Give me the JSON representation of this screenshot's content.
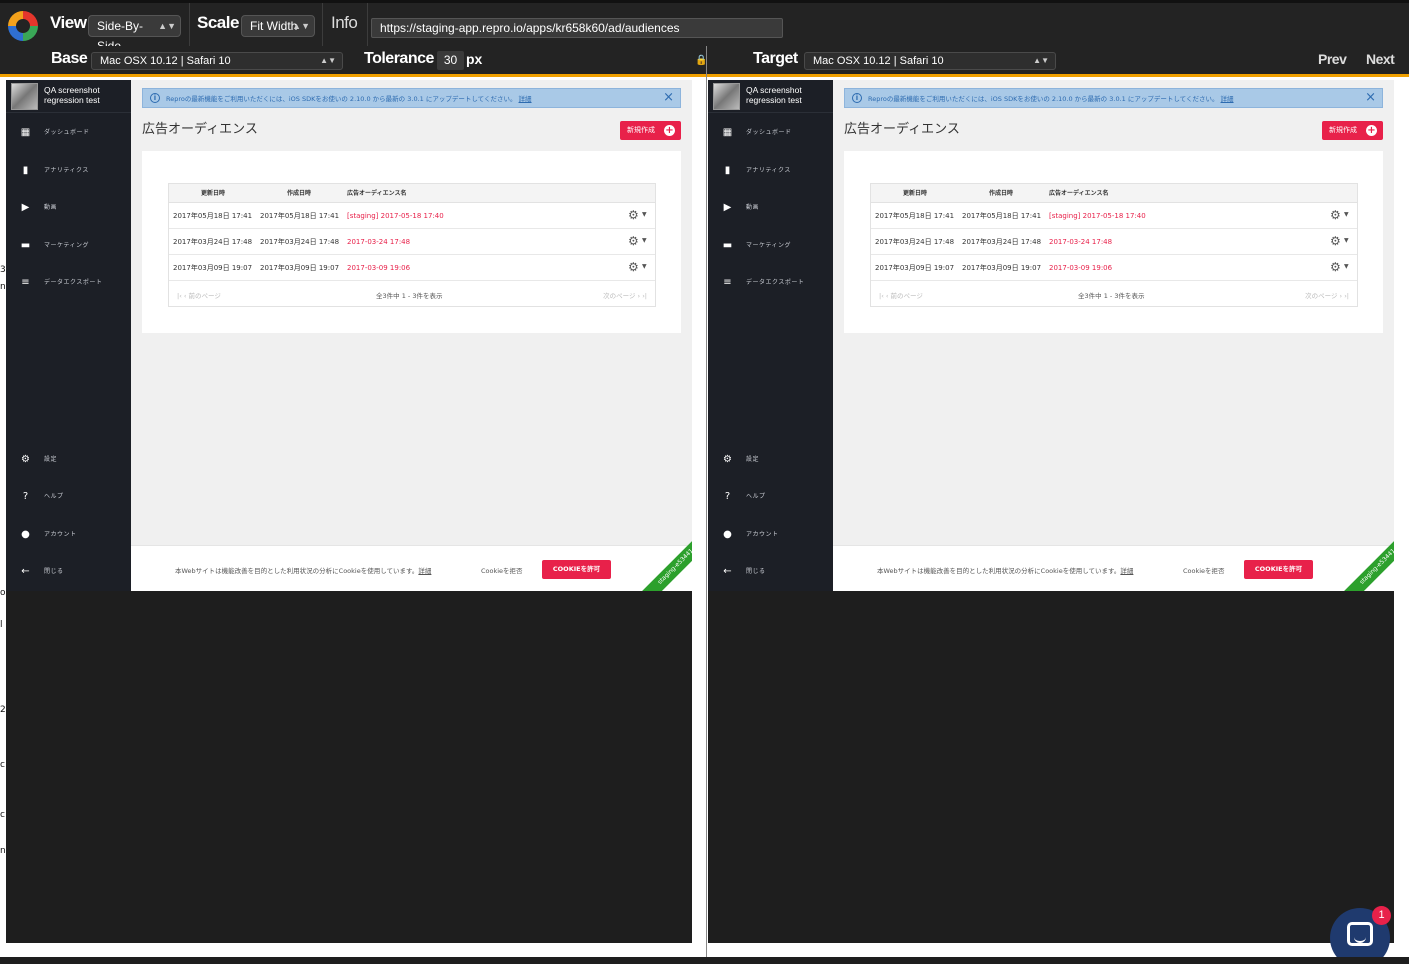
{
  "toolbar": {
    "view_label": "View",
    "view_value": "Side-By-Side",
    "scale_label": "Scale",
    "scale_value": "Fit Width",
    "info_label": "Info",
    "url": "https://staging-app.repro.io/apps/kr658k60/ad/audiences"
  },
  "subbar": {
    "base_label": "Base",
    "base_value": "Mac OSX 10.12 | Safari 10",
    "tolerance_label": "Tolerance",
    "tolerance_value": "30",
    "tolerance_unit": "px",
    "target_label": "Target",
    "target_value": "Mac OSX 10.12 | Safari 10",
    "prev_label": "Prev",
    "next_label": "Next"
  },
  "app": {
    "name_line1": "QA screenshot",
    "name_line2": "regression test",
    "nav": [
      {
        "icon": "dashboard-icon",
        "label": "ダッシュボード"
      },
      {
        "icon": "bar-chart-icon",
        "label": "アナリティクス"
      },
      {
        "icon": "play-icon",
        "label": "動画"
      },
      {
        "icon": "message-icon",
        "label": "マーケティング"
      },
      {
        "icon": "list-icon",
        "label": "データエクスポート"
      }
    ],
    "nav_bottom": [
      {
        "icon": "gear-icon",
        "label": "設定"
      },
      {
        "icon": "help-icon",
        "label": "ヘルプ"
      },
      {
        "icon": "account-icon",
        "label": "アカウント"
      },
      {
        "icon": "arrow-left-icon",
        "label": "閉じる"
      }
    ],
    "alert_text": "Reproの最新機能をご利用いただくには、iOS SDKをお使いの 2.10.0 から最新の 3.0.1 にアップデートしてください。",
    "alert_link": "詳細",
    "alert_close": "×",
    "page_title": "広告オーディエンス",
    "new_button": "新規作成",
    "columns": [
      "更新日時",
      "作成日時",
      "広告オーディエンス名"
    ],
    "rows": [
      {
        "updated": "2017年05月18日 17:41",
        "created": "2017年05月18日 17:41",
        "name": "[staging] 2017-05-18 17:40"
      },
      {
        "updated": "2017年03月24日 17:48",
        "created": "2017年03月24日 17:48",
        "name": "2017-03-24 17:48"
      },
      {
        "updated": "2017年03月09日 19:07",
        "created": "2017年03月09日 19:07",
        "name": "2017-03-09 19:06"
      }
    ],
    "pager_prev": "|‹ ‹ 前のページ",
    "pager_info": "全3件中 1 - 3件を表示",
    "pager_next": "次のページ › ›|",
    "cookie_text": "本Webサイトは機能改善を目的とした利用状況の分析にCookieを使用しています。",
    "cookie_link": "詳細",
    "cookie_refuse": "Cookieを拒否",
    "cookie_allow": "COOKIEを許可",
    "ribbon": "staging-e53441"
  },
  "left_edge_chars": [
    "3",
    "n",
    "",
    "",
    "",
    "",
    "",
    "o",
    "l",
    "",
    "",
    "2",
    "",
    "c",
    "",
    "",
    "c",
    "n"
  ],
  "chat_badge": "1",
  "colors": {
    "accent": "#e8214a",
    "orange_bar": "#f0a000",
    "sidebar_bg": "#1c1f26",
    "alert_bg": "#a9c9e7",
    "ribbon": "#2ca02c"
  }
}
